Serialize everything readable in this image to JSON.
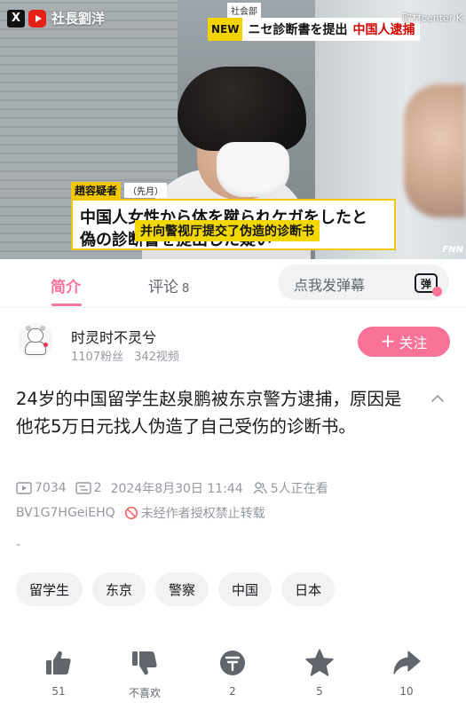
{
  "video": {
    "brand_name": "社長劉洋",
    "news_category": "社会部",
    "news_badge": "NEW",
    "news_headline_a": "ニセ診断書を提出",
    "news_headline_b": "中国人逮捕",
    "watermark": "取材center K",
    "subtitle_name": "趙容疑者",
    "subtitle_name_note": "（先月）",
    "subtitle_line1": "中国人女性から体を蹴られケガをしたと",
    "subtitle_line2": "偽の診断書を提出した疑い",
    "subtitle_chinese": "并向警视厅提交了伪造的诊断书",
    "channel_logo": "FNN"
  },
  "tabs": {
    "intro": "简介",
    "comments": "评论",
    "comments_count": "8",
    "danmaku_placeholder": "点我发弹幕",
    "danmaku_button": "弹"
  },
  "uploader": {
    "name": "时灵时不灵兮",
    "fans": "1107粉丝",
    "videos": "342视频",
    "follow_label": "关注"
  },
  "video_info": {
    "title": "24岁的中国留学生赵泉鹏被东京警方逮捕，原因是他花5万日元找人伪造了自己受伤的诊断书。",
    "views": "7034",
    "danmaku_count": "2",
    "publish_time": "2024年8月30日 11:44",
    "watching": "5人正在看",
    "bvid": "BV1G7HGeiEHQ",
    "no_repost": "未经作者授权禁止转载",
    "description": "-"
  },
  "tags": [
    "留学生",
    "东京",
    "警察",
    "中国",
    "日本"
  ],
  "actions": {
    "like": "51",
    "dislike": "不喜欢",
    "coin": "2",
    "favorite": "5",
    "share": "10"
  },
  "colors": {
    "accent": "#fb7299",
    "text_secondary": "#9499a0",
    "tag_bg": "#f1f2f3",
    "icon_dark": "#61666d"
  }
}
